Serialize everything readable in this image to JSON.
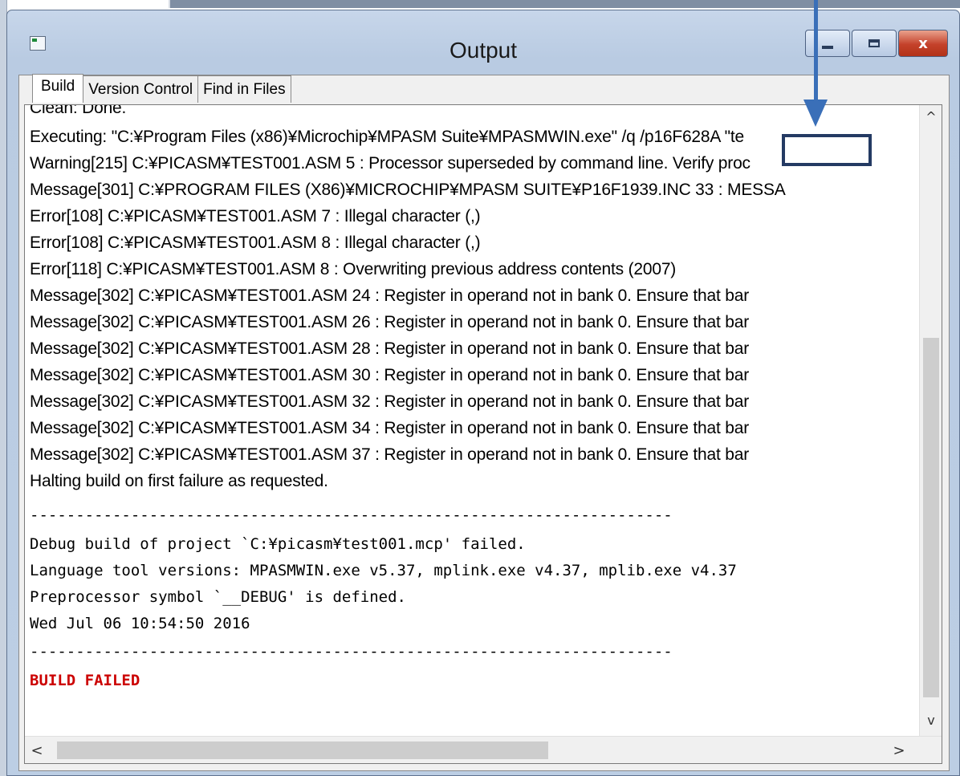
{
  "window": {
    "title": "Output",
    "controls": {
      "minimize": "",
      "maximize": "",
      "close": "x"
    }
  },
  "tabs": [
    {
      "label": "Build",
      "active": true
    },
    {
      "label": "Version Control",
      "active": false
    },
    {
      "label": "Find in Files",
      "active": false
    }
  ],
  "output": {
    "lines": [
      "Clean: Done.",
      "Executing: \"C:¥Program Files (x86)¥Microchip¥MPASM Suite¥MPASMWIN.exe\" /q /p16F628A \"te",
      "Warning[215] C:¥PICASM¥TEST001.ASM 5 : Processor superseded by command line.  Verify proc",
      "Message[301] C:¥PROGRAM FILES (X86)¥MICROCHIP¥MPASM SUITE¥P16F1939.INC 33 : MESSA",
      "Error[108]   C:¥PICASM¥TEST001.ASM 7 : Illegal character (,)",
      "Error[108]   C:¥PICASM¥TEST001.ASM 8 : Illegal character (,)",
      "Error[118]   C:¥PICASM¥TEST001.ASM 8 : Overwriting previous address contents (2007)",
      "Message[302] C:¥PICASM¥TEST001.ASM 24 : Register in operand not in bank 0.  Ensure that bar",
      "Message[302] C:¥PICASM¥TEST001.ASM 26 : Register in operand not in bank 0.  Ensure that bar",
      "Message[302] C:¥PICASM¥TEST001.ASM 28 : Register in operand not in bank 0.  Ensure that bar",
      "Message[302] C:¥PICASM¥TEST001.ASM 30 : Register in operand not in bank 0.  Ensure that bar",
      "Message[302] C:¥PICASM¥TEST001.ASM 32 : Register in operand not in bank 0.  Ensure that bar",
      "Message[302] C:¥PICASM¥TEST001.ASM 34 : Register in operand not in bank 0.  Ensure that bar",
      "Message[302] C:¥PICASM¥TEST001.ASM 37 : Register in operand not in bank 0.  Ensure that bar",
      "Halting build on first failure as requested."
    ],
    "separator": "----------------------------------------------------------------------",
    "summary": [
      "Debug build of project `C:¥picasm¥test001.mcp' failed.",
      "Language tool versions: MPASMWIN.exe v5.37, mplink.exe v4.37, mplib.exe v4.37",
      "Preprocessor symbol `__DEBUG' is defined.",
      "Wed Jul 06 10:54:50 2016"
    ],
    "result": "BUILD FAILED"
  },
  "scrollbars": {
    "up": "^",
    "down": "v",
    "left": "<",
    "right": ">"
  },
  "annotation": {
    "arrow_color": "#3a6fb8",
    "box_color": "#243a63"
  },
  "colors": {
    "failed_text": "#cc0000"
  }
}
